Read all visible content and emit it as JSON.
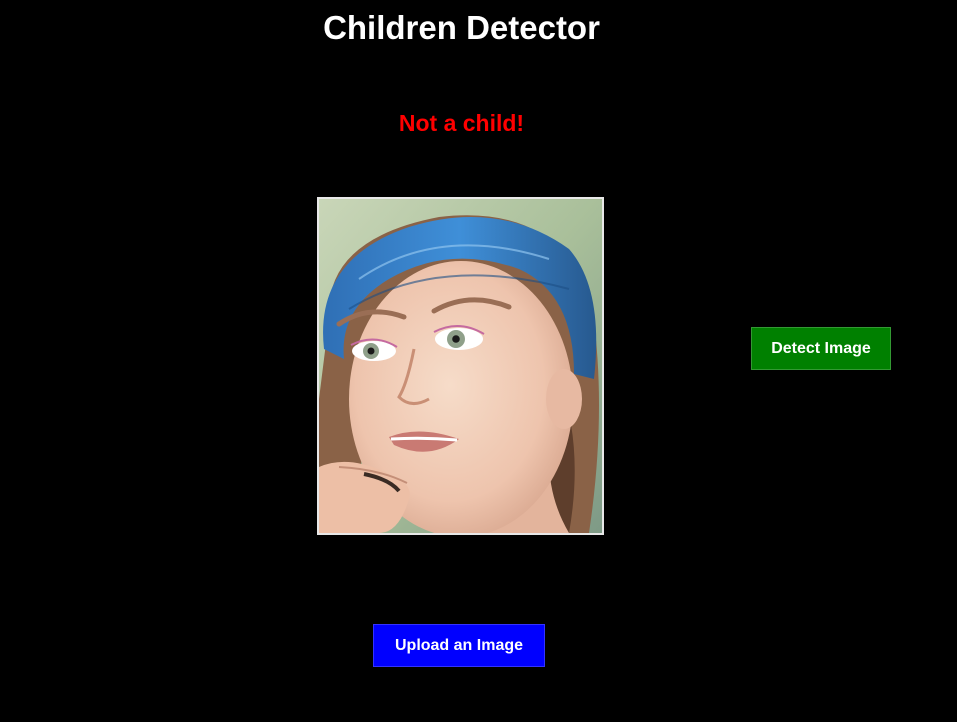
{
  "app": {
    "title": "Children Detector"
  },
  "result": {
    "text": "Not a child!",
    "color": "#ff0000"
  },
  "image_preview": {
    "icon": "uploaded-photo-portrait"
  },
  "buttons": {
    "detect_label": "Detect Image",
    "detect_color": "#008000",
    "upload_label": "Upload an Image",
    "upload_color": "#0000ff"
  }
}
